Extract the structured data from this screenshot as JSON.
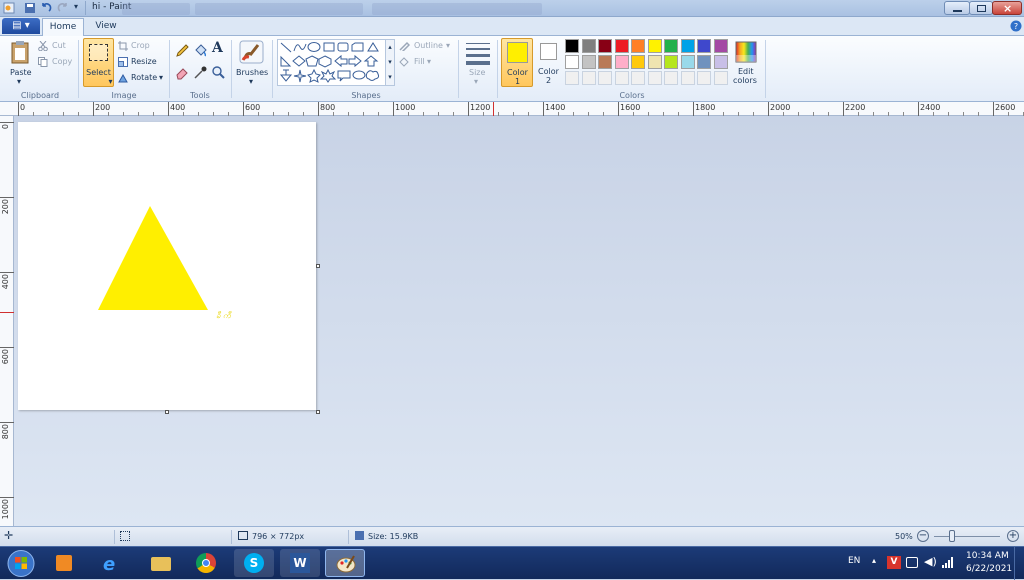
{
  "window": {
    "title": "hi - Paint"
  },
  "tabs": {
    "file": "▤ ▾",
    "home": "Home",
    "view": "View"
  },
  "ribbon": {
    "clipboard": {
      "label": "Clipboard",
      "paste": "Paste",
      "cut": "Cut",
      "copy": "Copy"
    },
    "image": {
      "label": "Image",
      "select": "Select",
      "crop": "Crop",
      "resize": "Resize",
      "rotate": "Rotate"
    },
    "tools": {
      "label": "Tools",
      "text_tool": "A"
    },
    "brushes": {
      "label": "Brushes"
    },
    "shapes": {
      "label": "Shapes",
      "outline": "Outline",
      "fill": "Fill"
    },
    "size": {
      "label": "Size"
    },
    "colors": {
      "label": "Colors",
      "color1_label": "Color",
      "color1_num": "1",
      "color2_label": "Color",
      "color2_num": "2",
      "edit_label": "Edit",
      "edit_label2": "colors",
      "color1_value": "#ffef00",
      "color2_value": "#ffffff",
      "row1": [
        "#000000",
        "#7f7f7f",
        "#880015",
        "#ed1c24",
        "#ff7f27",
        "#fff200",
        "#22b14c",
        "#00a2e8",
        "#3f48cc",
        "#a349a4"
      ],
      "row2": [
        "#ffffff",
        "#c3c3c3",
        "#b97a57",
        "#ffaec9",
        "#ffc90e",
        "#efe4b0",
        "#b5e61d",
        "#99d9ea",
        "#7092be",
        "#c8bfe7"
      ],
      "row3": [
        "#f0f0f0",
        "#f0f0f0",
        "#f0f0f0",
        "#f0f0f0",
        "#f0f0f0",
        "#f0f0f0",
        "#f0f0f0",
        "#f0f0f0",
        "#f0f0f0",
        "#f0f0f0"
      ]
    }
  },
  "ruler": {
    "top": [
      "0",
      "200",
      "400",
      "600",
      "800",
      "1000",
      "1200",
      "1400",
      "1600",
      "1800",
      "2000",
      "2200",
      "2400",
      "2600"
    ],
    "left": [
      "0",
      "200",
      "400",
      "600",
      "800",
      "1000"
    ]
  },
  "canvas": {
    "shape_color": "#ffef00",
    "text_color": "#e8d400",
    "text": "ခီ ကီ"
  },
  "status": {
    "dimensions": "796 × 772px",
    "size": "Size: 15.9KB",
    "zoom": "50%"
  },
  "taskbar": {
    "lang": "EN",
    "time": "10:34 AM",
    "date": "6/22/2021"
  }
}
